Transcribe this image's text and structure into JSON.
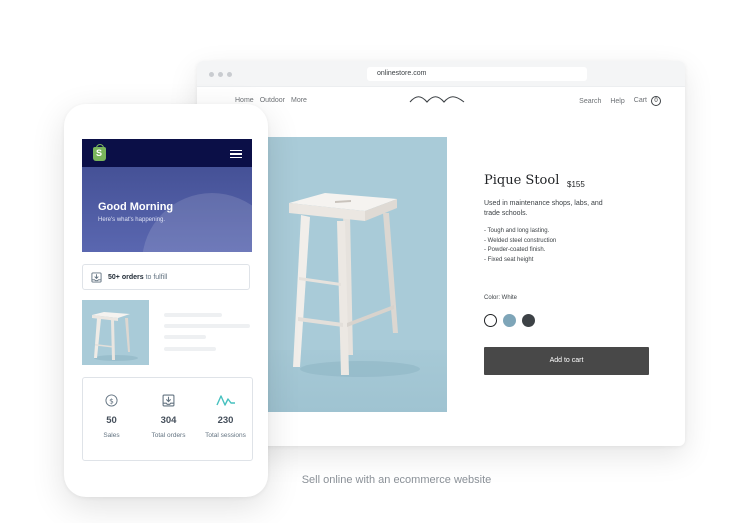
{
  "browser": {
    "url": "onlinestore.com",
    "nav_left": [
      "Home",
      "Outdoor",
      "More"
    ],
    "nav_right": {
      "search": "Search",
      "help": "Help",
      "cart": "Cart",
      "cart_count": "0"
    }
  },
  "product": {
    "title": "Pique Stool",
    "price": "$155",
    "description": "Used in maintenance shops, labs, and trade schools.",
    "features": [
      "- Tough and long lasting.",
      "- Welded steel construction",
      "- Powder-coated finish.",
      "- Fixed seat height"
    ],
    "color_label": "Color: White",
    "swatches": [
      {
        "name": "white",
        "color": "#ffffff",
        "selected": true
      },
      {
        "name": "blue",
        "color": "#7ea5b8",
        "selected": false
      },
      {
        "name": "dark",
        "color": "#3d4246",
        "selected": false
      }
    ],
    "add_to_cart": "Add to cart"
  },
  "phone": {
    "greeting": "Good Morning",
    "subtitle": "Here's what's happening.",
    "orders_bold": "50+ orders",
    "orders_rest": "to fulfill",
    "stats": [
      {
        "icon": "dollar-icon",
        "value": "50",
        "label": "Sales"
      },
      {
        "icon": "inbox-download-icon",
        "value": "304",
        "label": "Total orders"
      },
      {
        "icon": "activity-wave-icon",
        "value": "230",
        "label": "Total sessions"
      }
    ]
  },
  "caption": "Sell online with an ecommerce website",
  "colors": {
    "brand_green": "#7ab55c",
    "nav_dark": "#0b0f47",
    "header_blue": "#4b58a0",
    "accent_teal": "#47c1bf",
    "button_dark": "#484848"
  }
}
